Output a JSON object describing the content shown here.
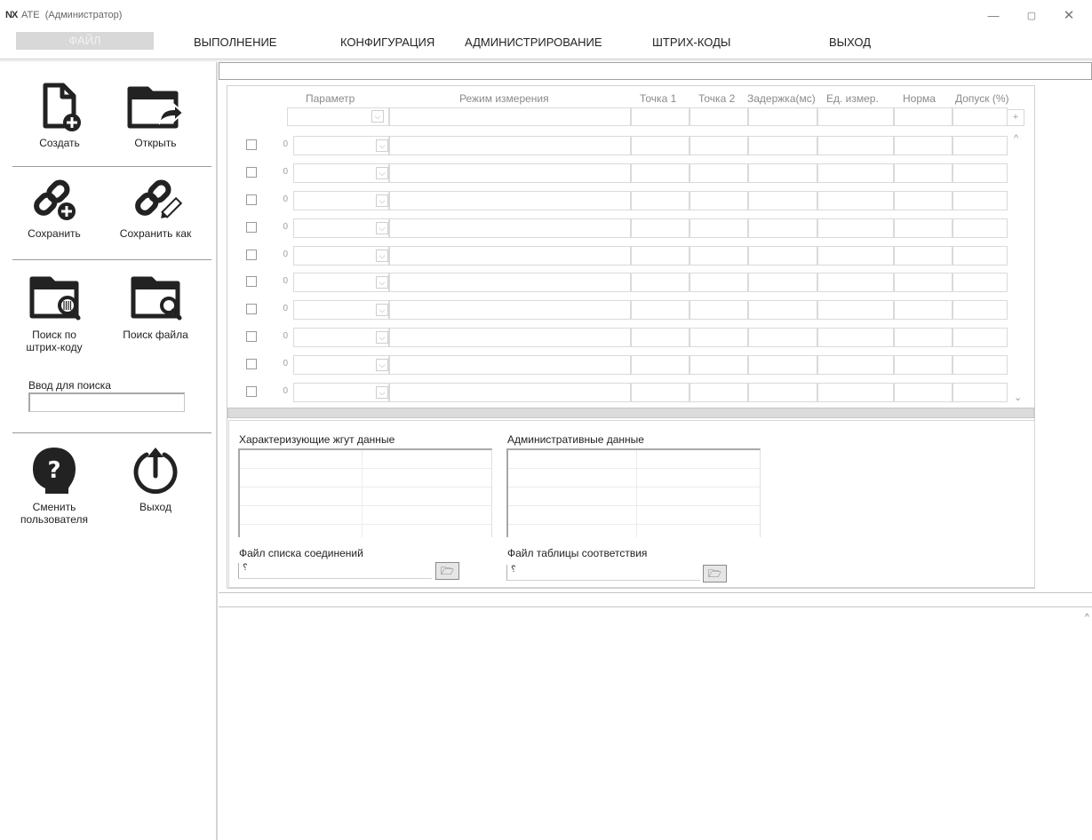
{
  "window": {
    "logo": "NX",
    "app_name": "ATE",
    "user_role": "(Администратор)",
    "minimize_glyph": "—",
    "maximize_glyph": "▢",
    "close_glyph": "✕"
  },
  "menu": {
    "file": "ФАЙЛ",
    "run": "ВЫПОЛНЕНИЕ",
    "config": "КОНФИГУРАЦИЯ",
    "admin": "АДМИНИСТРИРОВАНИЕ",
    "barcodes": "ШТРИХ-КОДЫ",
    "exit": "ВЫХОД"
  },
  "sidebar": {
    "create": "Создать",
    "open": "Открыть",
    "save": "Сохранить",
    "save_as": "Сохранить как",
    "search_barcode_1": "Поиск по",
    "search_barcode_2": "штрих-коду",
    "search_file": "Поиск файла",
    "search_input_label": "Ввод для поиска",
    "search_input_value": "",
    "switch_user_1": "Сменить",
    "switch_user_2": "пользователя",
    "exit": "Выход"
  },
  "table": {
    "headers": {
      "parameter": "Параметр",
      "mode": "Режим измерения",
      "point1": "Точка 1",
      "point2": "Точка 2",
      "delay": "Задержка(мс)",
      "unit": "Ед. измер.",
      "norm": "Норма",
      "tolerance": "Допуск (%)"
    },
    "add_row_glyph": "+",
    "row_numbers": [
      "0",
      "0",
      "0",
      "0",
      "0",
      "0",
      "0",
      "0",
      "0",
      "0"
    ],
    "dropdown_glyph": "⌵",
    "scroll_up_glyph": "^",
    "scroll_down_glyph": "⌄"
  },
  "lower": {
    "harness_label": "Характеризующие жгут данные",
    "admin_label": "Административные данные",
    "netlist_label": "Файл списка соединений",
    "mapping_label": "Файл таблицы соответствия",
    "netlist_value": "",
    "mapping_value": "",
    "field_glyph": "␦",
    "folder_glyph": "🗁"
  },
  "bottom": {
    "scroll_glyph": "^"
  }
}
